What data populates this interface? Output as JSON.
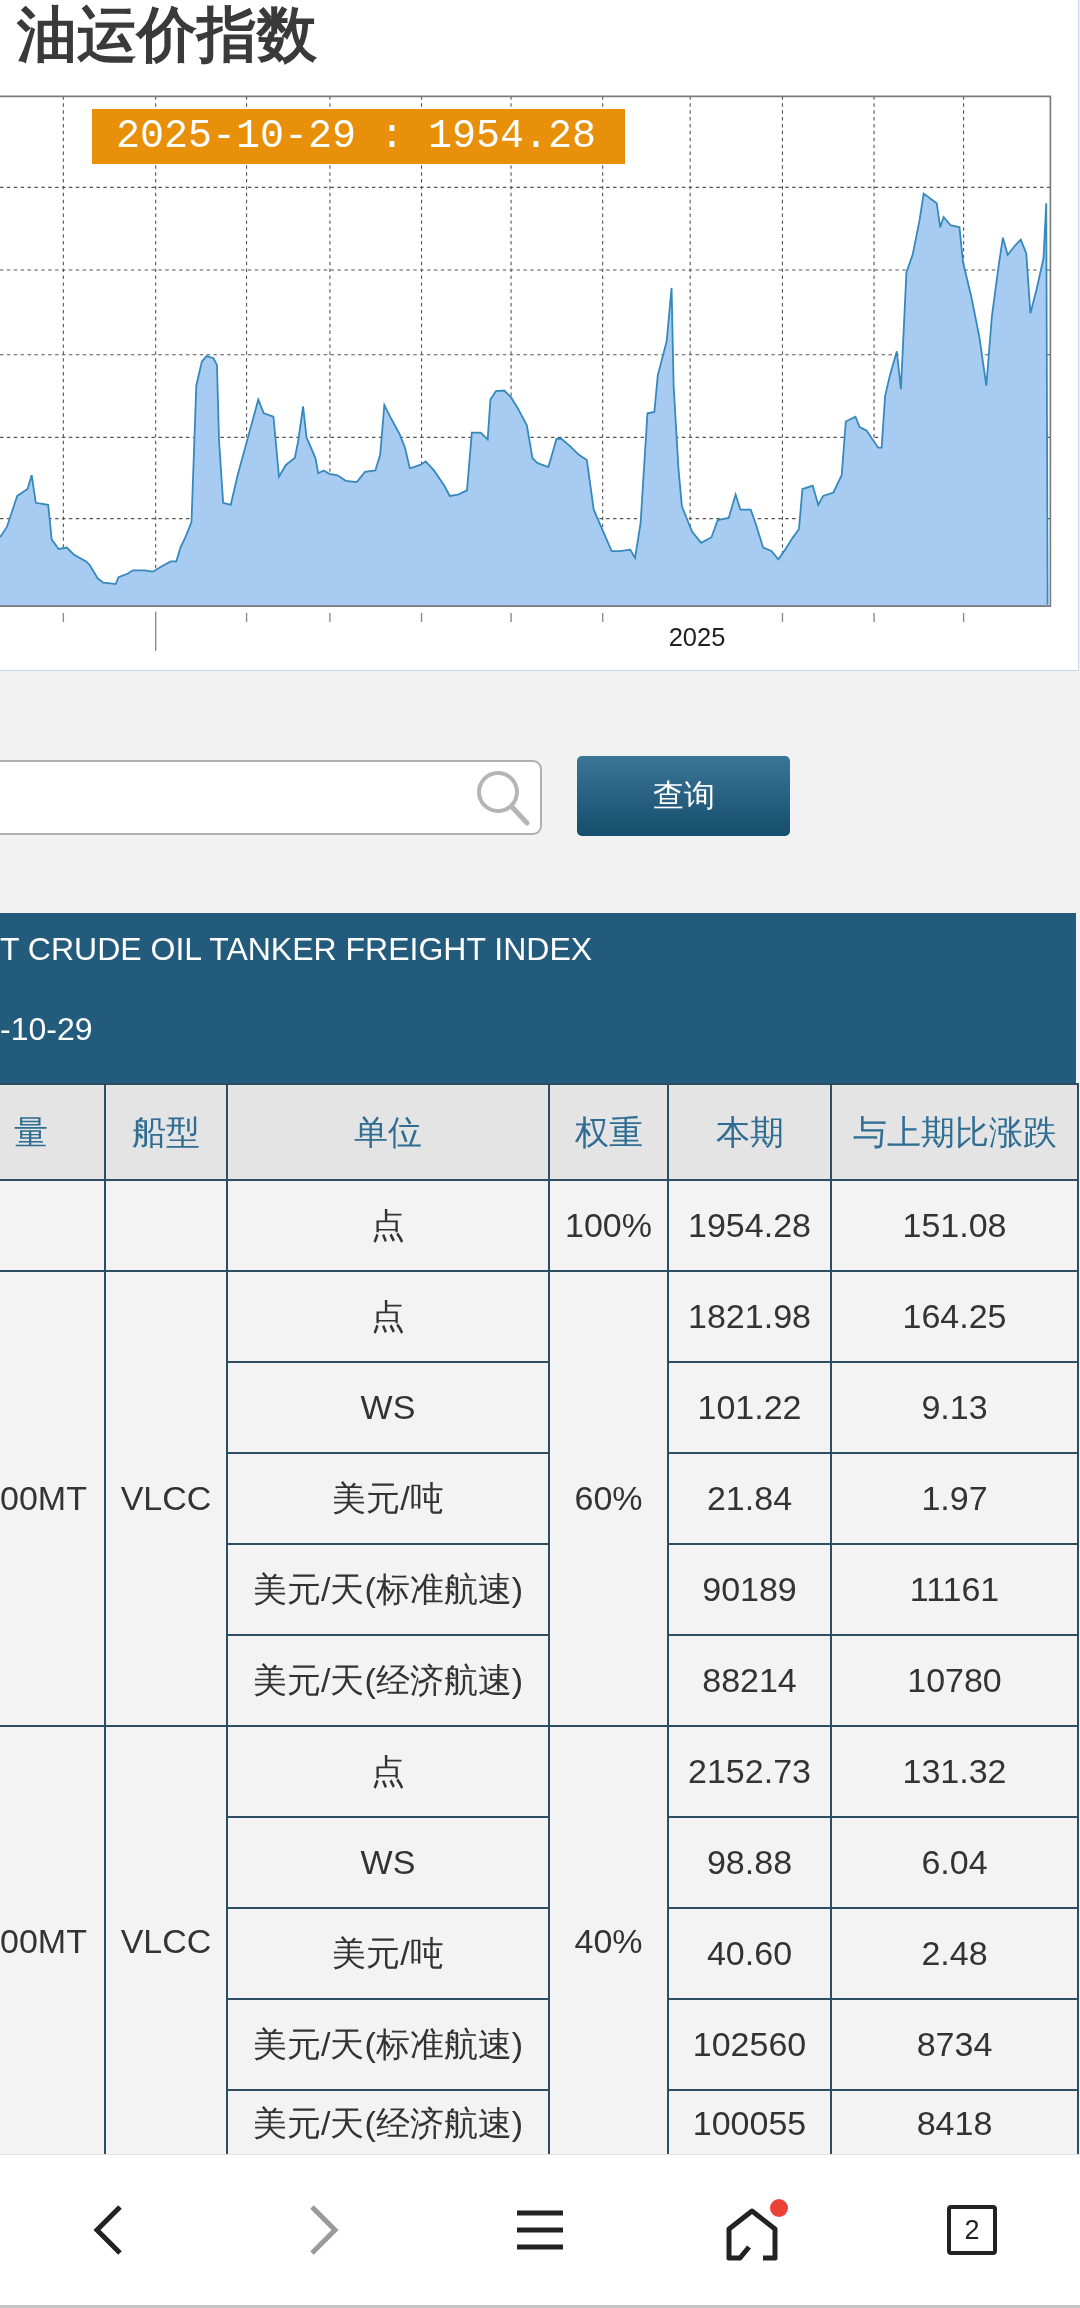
{
  "page_title": "油运价指数",
  "chart": {
    "tooltip": "2025-10-29 : 1954.28",
    "x_label": "2025"
  },
  "search": {
    "button": "查询"
  },
  "banner": {
    "title": "T CRUDE OIL TANKER FREIGHT INDEX",
    "date": "-10-29"
  },
  "table": {
    "columns": [
      "量",
      "船型",
      "单位",
      "权重",
      "本期",
      "与上期比涨跌"
    ],
    "groups": [
      {
        "weight": "100%",
        "rows": [
          {
            "unit": "点",
            "current": "1954.28",
            "change": "151.08"
          }
        ]
      },
      {
        "column_1": "00MT",
        "ship_type": "VLCC",
        "weight": "60%",
        "rows": [
          {
            "unit": "点",
            "current": "1821.98",
            "change": "164.25"
          },
          {
            "unit": "WS",
            "current": "101.22",
            "change": "9.13"
          },
          {
            "unit": "美元/吨",
            "current": "21.84",
            "change": "1.97"
          },
          {
            "unit": "美元/天(标准航速)",
            "current": "90189",
            "change": "11161"
          },
          {
            "unit": "美元/天(经济航速)",
            "current": "88214",
            "change": "10780"
          }
        ]
      },
      {
        "column_1": "00MT",
        "ship_type": "VLCC",
        "weight": "40%",
        "rows": [
          {
            "unit": "点",
            "current": "2152.73",
            "change": "131.32"
          },
          {
            "unit": "WS",
            "current": "98.88",
            "change": "6.04"
          },
          {
            "unit": "美元/吨",
            "current": "40.60",
            "change": "2.48"
          },
          {
            "unit": "美元/天(标准航速)",
            "current": "102560",
            "change": "8734"
          },
          {
            "unit": "美元/天(经济航速)",
            "current": "100055",
            "change": "8418"
          }
        ]
      }
    ]
  },
  "nav": [
    {
      "kind": "back",
      "disabled": false,
      "notification": false
    },
    {
      "kind": "forward",
      "disabled": true,
      "notification": false
    },
    {
      "kind": "menu",
      "disabled": false,
      "notification": false
    },
    {
      "kind": "home",
      "disabled": false,
      "notification": true
    },
    {
      "kind": "tabs",
      "disabled": false,
      "notification": false,
      "count": "2"
    }
  ]
}
